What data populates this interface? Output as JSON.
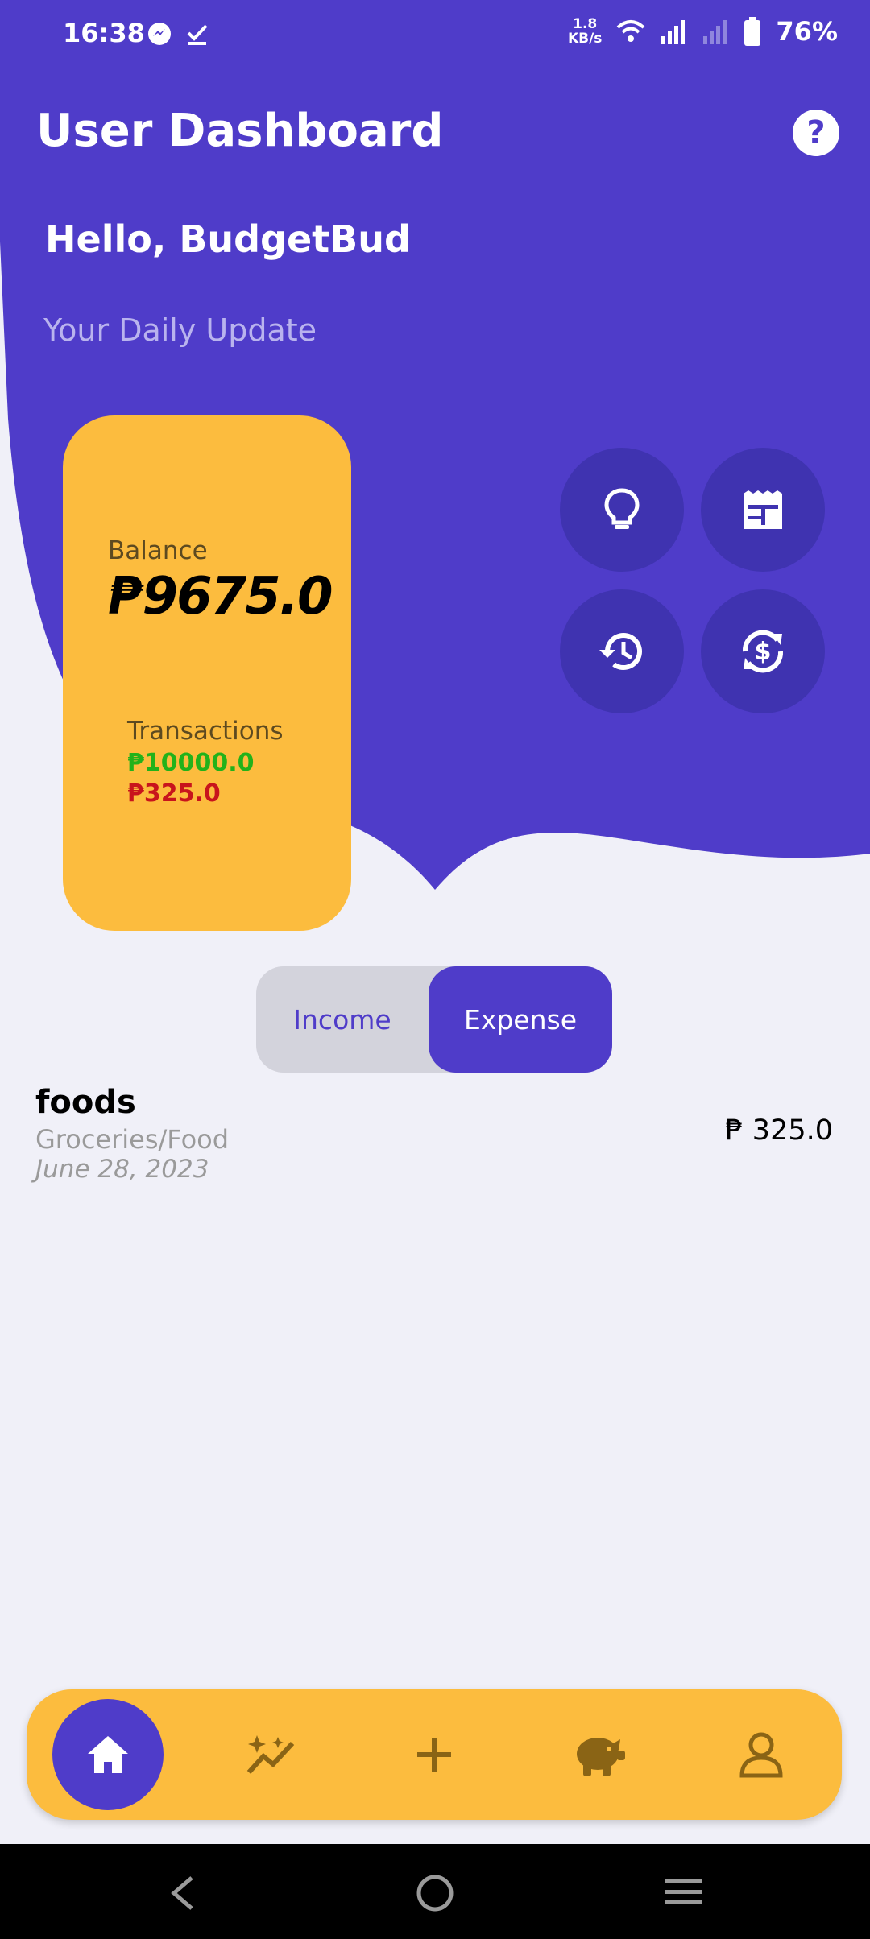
{
  "status_bar": {
    "time": "16:38",
    "net_speed_value": "1.8",
    "net_speed_unit": "KB/s",
    "battery": "76%"
  },
  "header": {
    "title": "User Dashboard",
    "help_icon": "help-circle-icon"
  },
  "greeting": "Hello, BudgetBud",
  "subtitle": "Your Daily Update",
  "balance_card": {
    "balance_label": "Balance",
    "balance_amount": "₱9675.0",
    "transactions_label": "Transactions",
    "income_total": "₱10000.0",
    "expense_total": "₱325.0"
  },
  "quick_actions": [
    "lightbulb-icon",
    "receipt-icon",
    "history-icon",
    "currency-exchange-icon"
  ],
  "toggle": {
    "income_label": "Income",
    "expense_label": "Expense",
    "selected": "Expense"
  },
  "transactions": [
    {
      "name": "foods",
      "category": "Groceries/Food",
      "date": "June 28, 2023",
      "amount": "₱ 325.0"
    }
  ],
  "bottom_nav": [
    "home-icon",
    "insights-icon",
    "add-icon",
    "savings-icon",
    "profile-icon"
  ],
  "colors": {
    "primary": "#4f3cc9",
    "accent": "#fcbc3e",
    "income": "#22b21a",
    "expense": "#c8141c",
    "background": "#f0f0f8"
  }
}
